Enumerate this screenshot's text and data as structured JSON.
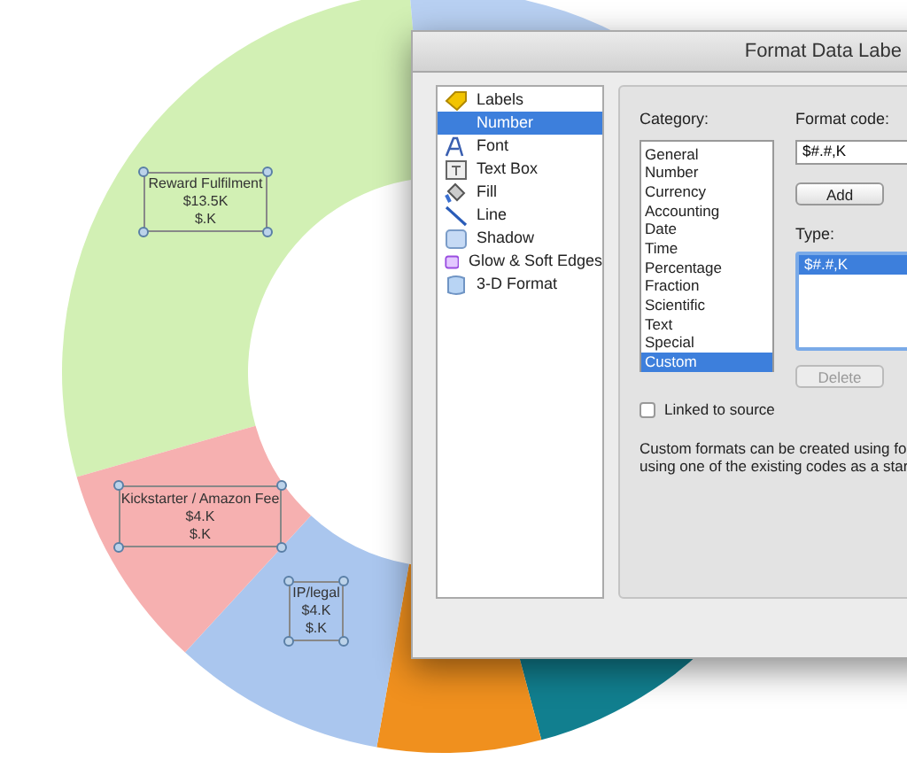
{
  "chart": {
    "labels": [
      {
        "lines": [
          "Reward Fulfilment",
          "$13.5K",
          "$.K"
        ]
      },
      {
        "lines": [
          "Kickstarter / Amazon Fee",
          "$4.K",
          "$.K"
        ]
      },
      {
        "lines": [
          "IP/legal",
          "$4.K",
          "$.K"
        ]
      }
    ]
  },
  "dialog": {
    "title": "Format Data Labe",
    "sidebar": [
      {
        "kind": "tag",
        "label": "Labels",
        "selected": false
      },
      {
        "kind": "none",
        "label": "Number",
        "selected": true
      },
      {
        "kind": "font",
        "label": "Font",
        "selected": false
      },
      {
        "kind": "textbox",
        "label": "Text Box",
        "selected": false
      },
      {
        "kind": "fill",
        "label": "Fill",
        "selected": false
      },
      {
        "kind": "line",
        "label": "Line",
        "selected": false
      },
      {
        "kind": "shadow",
        "label": "Shadow",
        "selected": false
      },
      {
        "kind": "glow",
        "label": "Glow & Soft Edges",
        "selected": false
      },
      {
        "kind": "cube",
        "label": "3-D Format",
        "selected": false
      }
    ],
    "category_label": "Category:",
    "categories": [
      {
        "label": "General",
        "selected": false
      },
      {
        "label": "Number",
        "selected": false
      },
      {
        "label": "Currency",
        "selected": false
      },
      {
        "label": "Accounting",
        "selected": false
      },
      {
        "label": "Date",
        "selected": false
      },
      {
        "label": "Time",
        "selected": false
      },
      {
        "label": "Percentage",
        "selected": false
      },
      {
        "label": "Fraction",
        "selected": false
      },
      {
        "label": "Scientific",
        "selected": false
      },
      {
        "label": "Text",
        "selected": false
      },
      {
        "label": "Special",
        "selected": false
      },
      {
        "label": "Custom",
        "selected": true
      }
    ],
    "format_code_label": "Format code:",
    "format_code": "$#.#,K",
    "add_button": "Add",
    "type_label": "Type:",
    "types": [
      {
        "label": "$#.#,K",
        "selected": true
      }
    ],
    "delete_button": {
      "label": "Delete",
      "disabled": true
    },
    "linked": {
      "label": "Linked to source",
      "checked": false
    },
    "description": [
      "Custom formats can be created using fo",
      "using one of the existing codes as a star"
    ]
  }
}
